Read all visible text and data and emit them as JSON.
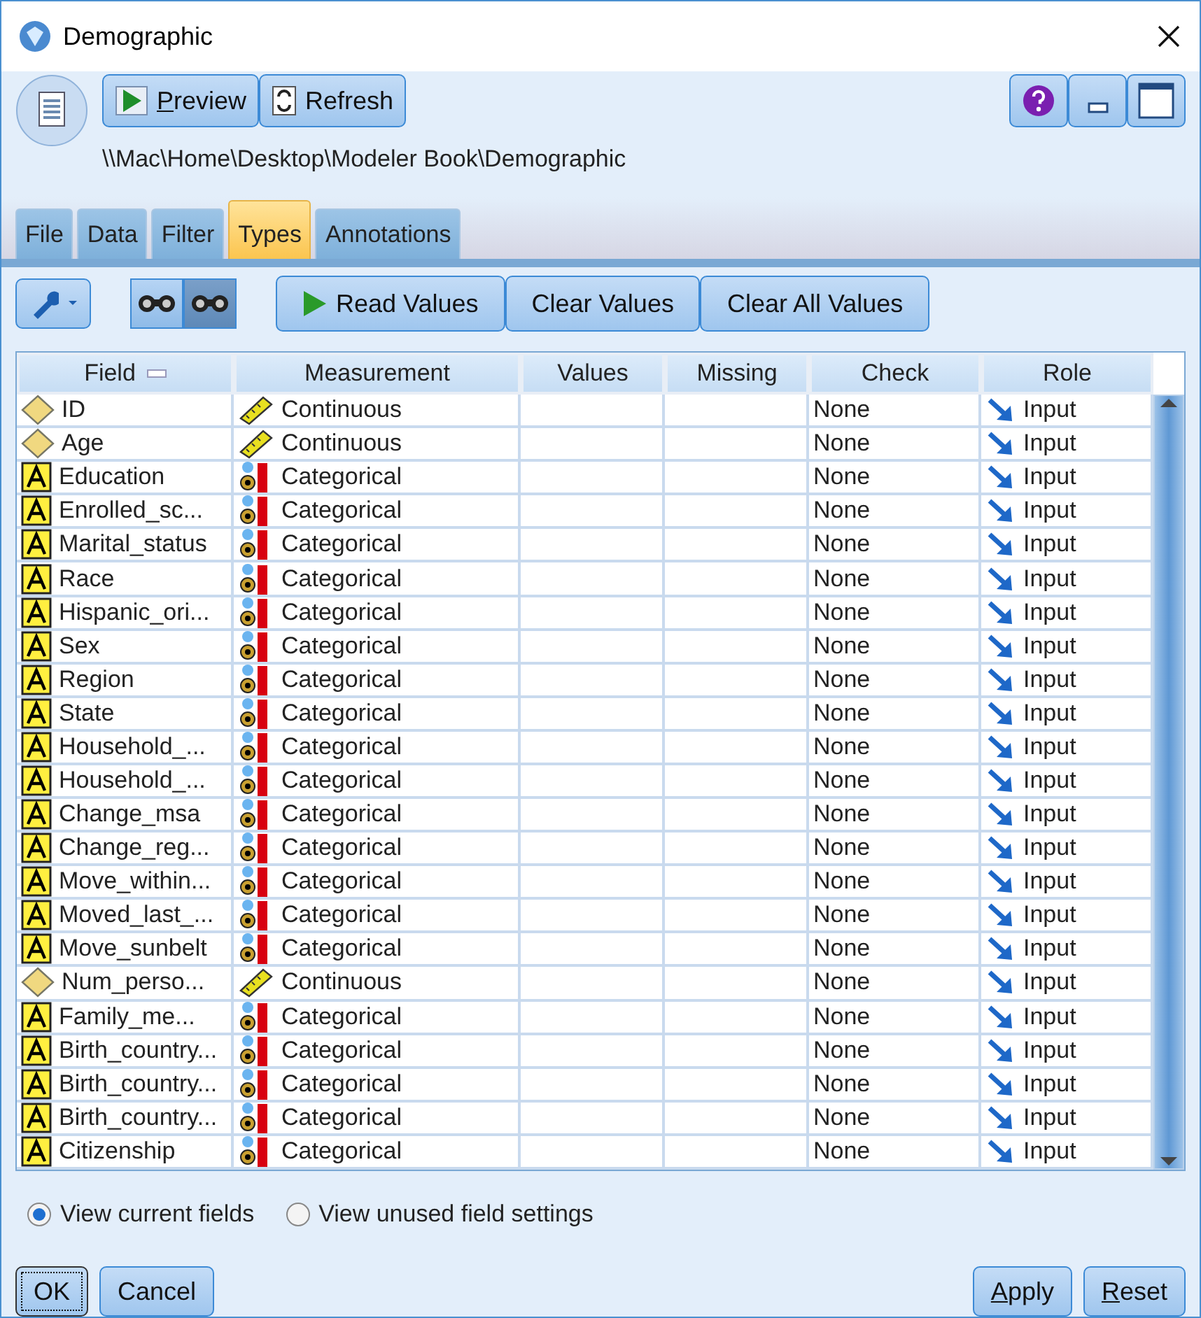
{
  "window": {
    "title": "Demographic"
  },
  "header_buttons": [
    {
      "label": "Preview",
      "kind": "preview",
      "mnemonic": true
    },
    {
      "label": "Refresh",
      "kind": "refresh",
      "mnemonic": false
    }
  ],
  "path": "\\\\Mac\\Home\\Desktop\\Modeler Book\\Demographic",
  "tabs": [
    {
      "label": "File",
      "selected": false
    },
    {
      "label": "Data",
      "selected": false
    },
    {
      "label": "Filter",
      "selected": false
    },
    {
      "label": "Types",
      "selected": true
    },
    {
      "label": "Annotations",
      "selected": false
    }
  ],
  "view_toggles": [
    {
      "selected": false
    },
    {
      "selected": true
    }
  ],
  "toolbar_buttons": [
    {
      "label": "Read Values",
      "play": true
    },
    {
      "label": "Clear Values",
      "play": false
    },
    {
      "label": "Clear All Values",
      "play": false
    }
  ],
  "table": {
    "columns": [
      "Field",
      "Measurement",
      "Values",
      "Missing",
      "Check",
      "Role"
    ],
    "rows": [
      {
        "field": "ID",
        "kind": "continuous",
        "measurement": "Continuous",
        "check": "None",
        "role": "Input"
      },
      {
        "field": "Age",
        "kind": "continuous",
        "measurement": "Continuous",
        "check": "None",
        "role": "Input"
      },
      {
        "field": "Education",
        "kind": "categorical",
        "measurement": "Categorical",
        "check": "None",
        "role": "Input"
      },
      {
        "field": "Enrolled_sc...",
        "kind": "categorical",
        "measurement": "Categorical",
        "check": "None",
        "role": "Input"
      },
      {
        "field": "Marital_status",
        "kind": "categorical",
        "measurement": "Categorical",
        "check": "None",
        "role": "Input"
      },
      {
        "field": "Race",
        "kind": "categorical",
        "measurement": "Categorical",
        "check": "None",
        "role": "Input"
      },
      {
        "field": "Hispanic_ori...",
        "kind": "categorical",
        "measurement": "Categorical",
        "check": "None",
        "role": "Input"
      },
      {
        "field": "Sex",
        "kind": "categorical",
        "measurement": "Categorical",
        "check": "None",
        "role": "Input"
      },
      {
        "field": "Region",
        "kind": "categorical",
        "measurement": "Categorical",
        "check": "None",
        "role": "Input"
      },
      {
        "field": "State",
        "kind": "categorical",
        "measurement": "Categorical",
        "check": "None",
        "role": "Input"
      },
      {
        "field": "Household_...",
        "kind": "categorical",
        "measurement": "Categorical",
        "check": "None",
        "role": "Input"
      },
      {
        "field": "Household_...",
        "kind": "categorical",
        "measurement": "Categorical",
        "check": "None",
        "role": "Input"
      },
      {
        "field": "Change_msa",
        "kind": "categorical",
        "measurement": "Categorical",
        "check": "None",
        "role": "Input"
      },
      {
        "field": "Change_reg...",
        "kind": "categorical",
        "measurement": "Categorical",
        "check": "None",
        "role": "Input"
      },
      {
        "field": "Move_within...",
        "kind": "categorical",
        "measurement": "Categorical",
        "check": "None",
        "role": "Input"
      },
      {
        "field": "Moved_last_...",
        "kind": "categorical",
        "measurement": "Categorical",
        "check": "None",
        "role": "Input"
      },
      {
        "field": "Move_sunbelt",
        "kind": "categorical",
        "measurement": "Categorical",
        "check": "None",
        "role": "Input"
      },
      {
        "field": "Num_perso...",
        "kind": "continuous",
        "measurement": "Continuous",
        "check": "None",
        "role": "Input"
      },
      {
        "field": "Family_me...",
        "kind": "categorical",
        "measurement": "Categorical",
        "check": "None",
        "role": "Input"
      },
      {
        "field": "Birth_country...",
        "kind": "categorical",
        "measurement": "Categorical",
        "check": "None",
        "role": "Input"
      },
      {
        "field": "Birth_country...",
        "kind": "categorical",
        "measurement": "Categorical",
        "check": "None",
        "role": "Input"
      },
      {
        "field": "Birth_country...",
        "kind": "categorical",
        "measurement": "Categorical",
        "check": "None",
        "role": "Input"
      },
      {
        "field": "Citizenship",
        "kind": "categorical",
        "measurement": "Categorical",
        "check": "None",
        "role": "Input"
      }
    ]
  },
  "view_options": [
    {
      "label": "View current fields",
      "checked": true
    },
    {
      "label": "View unused field settings",
      "checked": false
    }
  ],
  "footer_left": [
    {
      "label": "OK",
      "focused": true,
      "mnemonic": false
    },
    {
      "label": "Cancel",
      "focused": false,
      "mnemonic": false
    }
  ],
  "footer_right": [
    {
      "label": "Apply",
      "focused": false,
      "mnemonic": true
    },
    {
      "label": "Reset",
      "focused": false,
      "mnemonic": true
    }
  ]
}
